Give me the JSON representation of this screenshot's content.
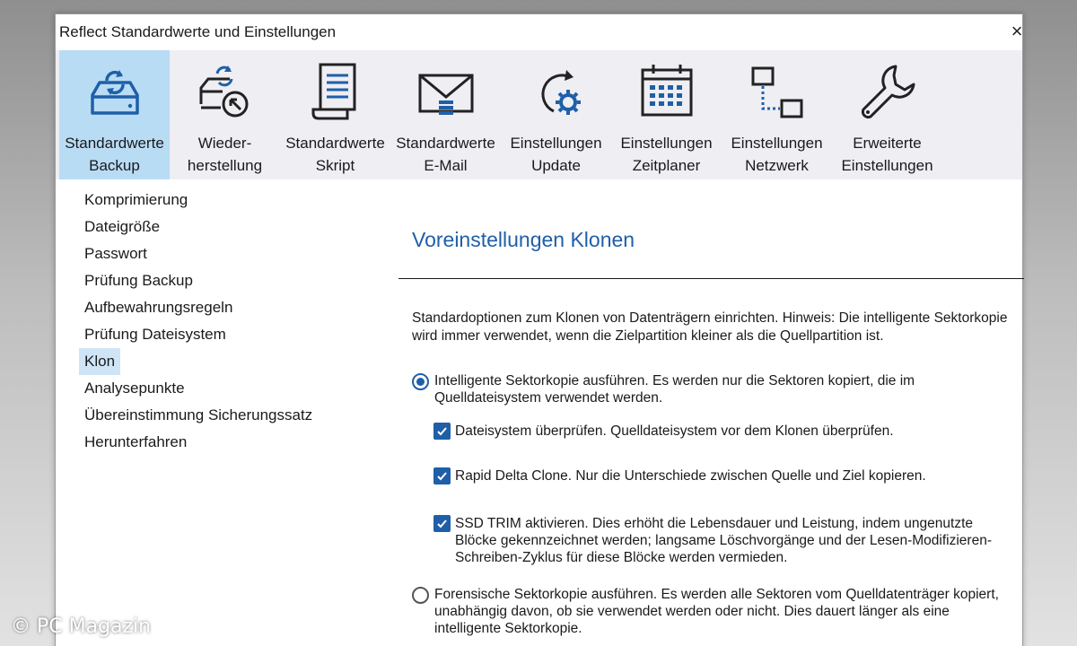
{
  "window": {
    "title": "Reflect Standardwerte und Einstellungen",
    "close_label": "×"
  },
  "toolbar": {
    "accent_color": "#1f5fa8",
    "active_bg": "#b9dcf5",
    "items": [
      {
        "icon": "backup-drive-icon",
        "line1": "Standardwerte",
        "line2": "Backup"
      },
      {
        "icon": "restore-icon",
        "line1": "Wieder-",
        "line2": "herstellung"
      },
      {
        "icon": "script-icon",
        "line1": "Standardwerte",
        "line2": "Skript"
      },
      {
        "icon": "email-icon",
        "line1": "Standardwerte",
        "line2": "E-Mail"
      },
      {
        "icon": "update-icon",
        "line1": "Einstellungen",
        "line2": "Update"
      },
      {
        "icon": "calendar-icon",
        "line1": "Einstellungen",
        "line2": "Zeitplaner"
      },
      {
        "icon": "network-icon",
        "line1": "Einstellungen",
        "line2": "Netzwerk"
      },
      {
        "icon": "wrench-icon",
        "line1": "Erweiterte",
        "line2": "Einstellungen"
      }
    ]
  },
  "sidebar": {
    "items": [
      "Komprimierung",
      "Dateigröße",
      "Passwort",
      "Prüfung Backup",
      "Aufbewahrungsregeln",
      "Prüfung Dateisystem",
      "Klon",
      "Analysepunkte",
      "Übereinstimmung Sicherungssatz",
      "Herunterfahren"
    ],
    "selected": "Klon"
  },
  "content": {
    "heading": "Voreinstellungen Klonen",
    "description": "Standardoptionen zum Klonen von Datenträgern einrichten. Hinweis: Die intelligente Sektorkopie wird immer verwendet, wenn die Zielpartition kleiner als die Quellpartition ist.",
    "option_intelligent": "Intelligente Sektorkopie ausführen. Es werden nur die Sektoren kopiert, die im Quelldateisystem verwendet werden.",
    "check_filesystem": "Dateisystem überprüfen. Quelldateisystem vor dem Klonen überprüfen.",
    "check_rdc": "Rapid Delta Clone. Nur die Unterschiede zwischen Quelle und Ziel kopieren.",
    "check_trim": "SSD TRIM aktivieren. Dies erhöht die Lebensdauer und Leistung, indem ungenutzte Blöcke gekennzeichnet werden; langsame Löschvorgänge und der Lesen-Modifizieren-Schreiben-Zyklus für diese Blöcke werden vermieden.",
    "option_forensic": "Forensische Sektorkopie ausführen. Es werden alle Sektoren vom Quelldatenträger kopiert, unabhängig davon, ob sie verwendet werden oder nicht. Dies dauert länger als eine intelligente Sektorkopie."
  },
  "watermark": "© PC Magazin"
}
